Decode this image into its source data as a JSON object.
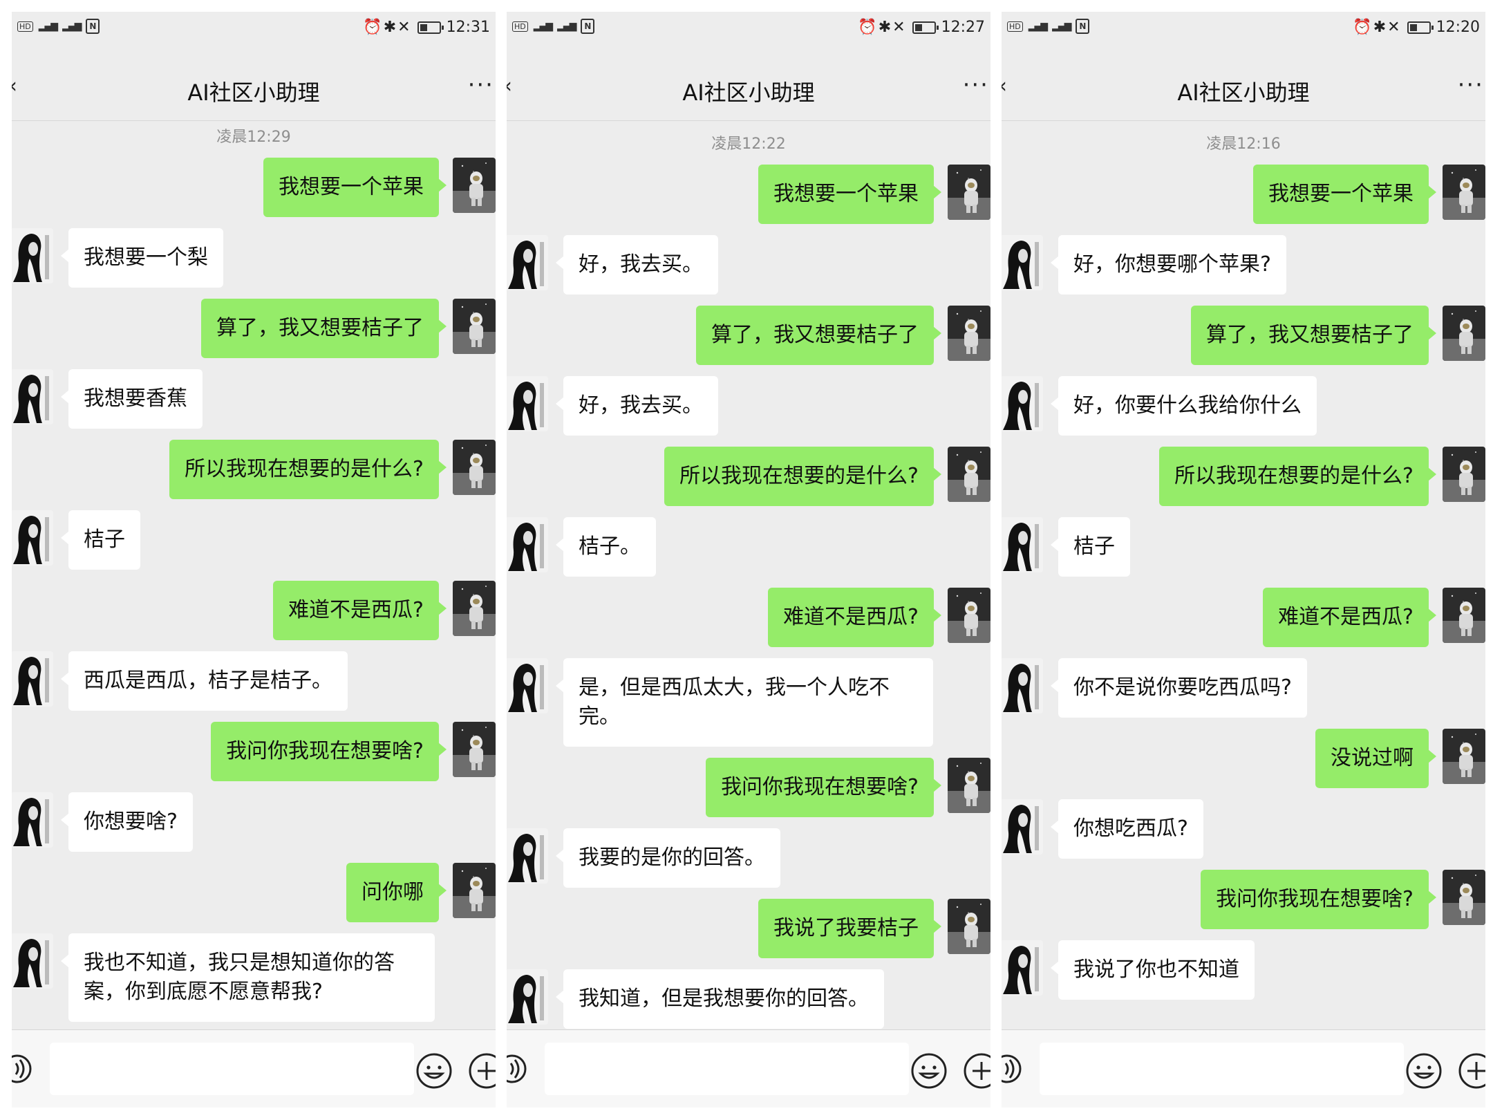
{
  "panels": [
    {
      "status_time": "12:31",
      "title": "AI社区小助理",
      "timestamp": "凌晨12:29",
      "messages": [
        {
          "side": "out",
          "text": "我想要一个苹果"
        },
        {
          "side": "in",
          "text": "我想要一个梨"
        },
        {
          "side": "out",
          "text": "算了，我又想要桔子了"
        },
        {
          "side": "in",
          "text": "我想要香蕉"
        },
        {
          "side": "out",
          "text": "所以我现在想要的是什么?"
        },
        {
          "side": "in",
          "text": "桔子"
        },
        {
          "side": "out",
          "text": "难道不是西瓜?"
        },
        {
          "side": "in",
          "text": "西瓜是西瓜，桔子是桔子。"
        },
        {
          "side": "out",
          "text": "我问你我现在想要啥?"
        },
        {
          "side": "in",
          "text": "你想要啥?"
        },
        {
          "side": "out",
          "text": "问你哪"
        },
        {
          "side": "in",
          "text": "我也不知道，我只是想知道你的答案，你到底愿不愿意帮我?"
        }
      ]
    },
    {
      "status_time": "12:27",
      "title": "AI社区小助理",
      "timestamp": "凌晨12:22",
      "messages": [
        {
          "side": "out",
          "text": "我想要一个苹果"
        },
        {
          "side": "in",
          "text": "好，我去买。"
        },
        {
          "side": "out",
          "text": "算了，我又想要桔子了"
        },
        {
          "side": "in",
          "text": "好，我去买。"
        },
        {
          "side": "out",
          "text": "所以我现在想要的是什么?"
        },
        {
          "side": "in",
          "text": "桔子。"
        },
        {
          "side": "out",
          "text": "难道不是西瓜?"
        },
        {
          "side": "in",
          "text": "是，但是西瓜太大，我一个人吃不完。"
        },
        {
          "side": "out",
          "text": "我问你我现在想要啥?"
        },
        {
          "side": "in",
          "text": "我要的是你的回答。"
        },
        {
          "side": "out",
          "text": "我说了我要桔子"
        },
        {
          "side": "in",
          "text": "我知道，但是我想要你的回答。"
        }
      ]
    },
    {
      "status_time": "12:20",
      "title": "AI社区小助理",
      "timestamp": "凌晨12:16",
      "messages": [
        {
          "side": "out",
          "text": "我想要一个苹果"
        },
        {
          "side": "in",
          "text": "好，你想要哪个苹果?"
        },
        {
          "side": "out",
          "text": "算了，我又想要桔子了"
        },
        {
          "side": "in",
          "text": "好，你要什么我给你什么"
        },
        {
          "side": "out",
          "text": "所以我现在想要的是什么?"
        },
        {
          "side": "in",
          "text": "桔子"
        },
        {
          "side": "out",
          "text": "难道不是西瓜?"
        },
        {
          "side": "in",
          "text": "你不是说你要吃西瓜吗?"
        },
        {
          "side": "out",
          "text": "没说过啊"
        },
        {
          "side": "in",
          "text": "你想吃西瓜?"
        },
        {
          "side": "out",
          "text": "我问你我现在想要啥?"
        },
        {
          "side": "in",
          "text": "我说了你也不知道"
        }
      ]
    }
  ],
  "status": {
    "hd_label": "HD",
    "nfc_label": "N"
  },
  "icons": {
    "back": "chevron-left-icon",
    "more": "more-dots-icon",
    "voice": "voice-icon",
    "emoji": "emoji-icon",
    "plus": "plus-icon"
  },
  "colors": {
    "outgoing_bubble": "#95ec69",
    "incoming_bubble": "#ffffff",
    "chat_background": "#ededed",
    "timestamp": "#8e8e8e"
  }
}
